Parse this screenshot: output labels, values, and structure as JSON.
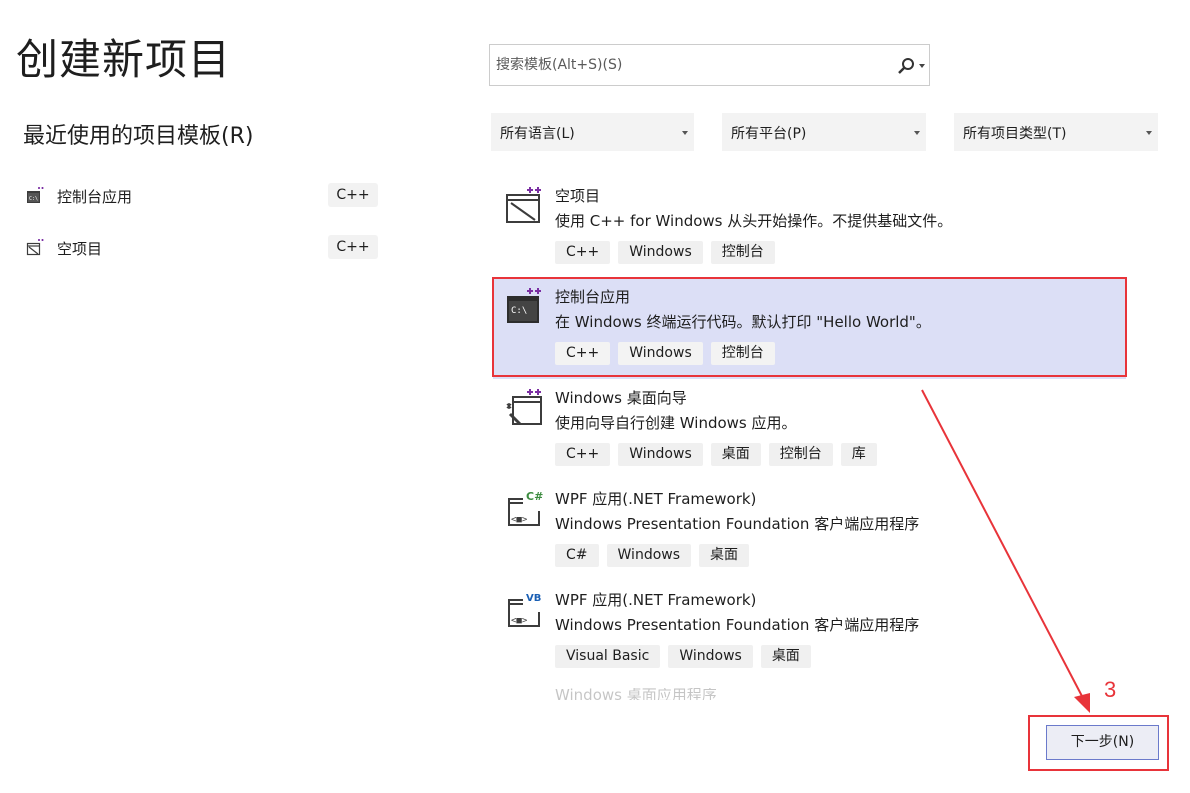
{
  "page_title": "创建新项目",
  "recent": {
    "title": "最近使用的项目模板(R)",
    "items": [
      {
        "label": "控制台应用",
        "tag": "C++",
        "icon": "console-app-icon"
      },
      {
        "label": "空项目",
        "tag": "C++",
        "icon": "empty-project-icon"
      }
    ]
  },
  "search": {
    "placeholder": "搜索模板(Alt+S)(S)",
    "icon": "search-icon"
  },
  "filters": {
    "language": "所有语言(L)",
    "platform": "所有平台(P)",
    "project_type": "所有项目类型(T)"
  },
  "templates": [
    {
      "name": "空项目",
      "desc": "使用 C++ for Windows 从头开始操作。不提供基础文件。",
      "tags": [
        "C++",
        "Windows",
        "控制台"
      ],
      "icon": "empty-project-icon",
      "selected": false
    },
    {
      "name": "控制台应用",
      "desc": "在 Windows 终端运行代码。默认打印 \"Hello World\"。",
      "tags": [
        "C++",
        "Windows",
        "控制台"
      ],
      "icon": "console-app-icon",
      "selected": true
    },
    {
      "name": "Windows 桌面向导",
      "desc": "使用向导自行创建 Windows 应用。",
      "tags": [
        "C++",
        "Windows",
        "桌面",
        "控制台",
        "库"
      ],
      "icon": "desktop-wizard-icon",
      "selected": false
    },
    {
      "name": "WPF 应用(.NET Framework)",
      "desc": "Windows Presentation Foundation 客户端应用程序",
      "tags": [
        "C#",
        "Windows",
        "桌面"
      ],
      "icon": "wpf-csharp-icon",
      "selected": false
    },
    {
      "name": "WPF 应用(.NET Framework)",
      "desc": "Windows Presentation Foundation 客户端应用程序",
      "tags": [
        "Visual Basic",
        "Windows",
        "桌面"
      ],
      "icon": "wpf-vb-icon",
      "selected": false
    }
  ],
  "faded_item": "Windows 桌面应用程序",
  "next_button": "下一步(N)",
  "annotation": {
    "step_number": "3",
    "color": "#e8343a"
  },
  "colors": {
    "selected_bg": "#dcdff6",
    "accent": "#6b7acb",
    "plus_purple": "#7b2fa3",
    "csharp_green": "#3d8c40",
    "vb_blue": "#1a5fb4"
  }
}
